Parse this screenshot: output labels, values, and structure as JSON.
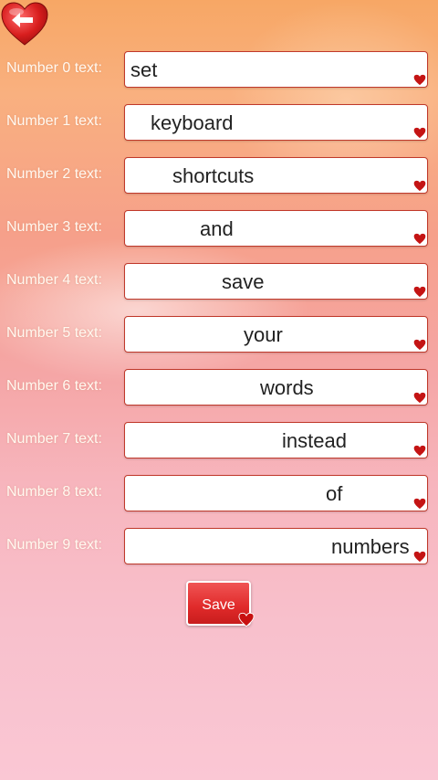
{
  "back_icon": "heart-back-arrow-icon",
  "rows": [
    {
      "label": "Number 0 text:",
      "value": "set"
    },
    {
      "label": "Number 1 text:",
      "value": "keyboard"
    },
    {
      "label": "Number 2 text:",
      "value": "shortcuts"
    },
    {
      "label": "Number 3 text:",
      "value": "and"
    },
    {
      "label": "Number 4 text:",
      "value": "save"
    },
    {
      "label": "Number 5 text:",
      "value": "your"
    },
    {
      "label": "Number 6 text:",
      "value": "words"
    },
    {
      "label": "Number 7 text:",
      "value": "instead"
    },
    {
      "label": "Number 8 text:",
      "value": "of"
    },
    {
      "label": "Number 9 text:",
      "value": "numbers"
    }
  ],
  "save_label": "Save",
  "colors": {
    "accent": "#e02a2a",
    "border": "#c0392b"
  }
}
